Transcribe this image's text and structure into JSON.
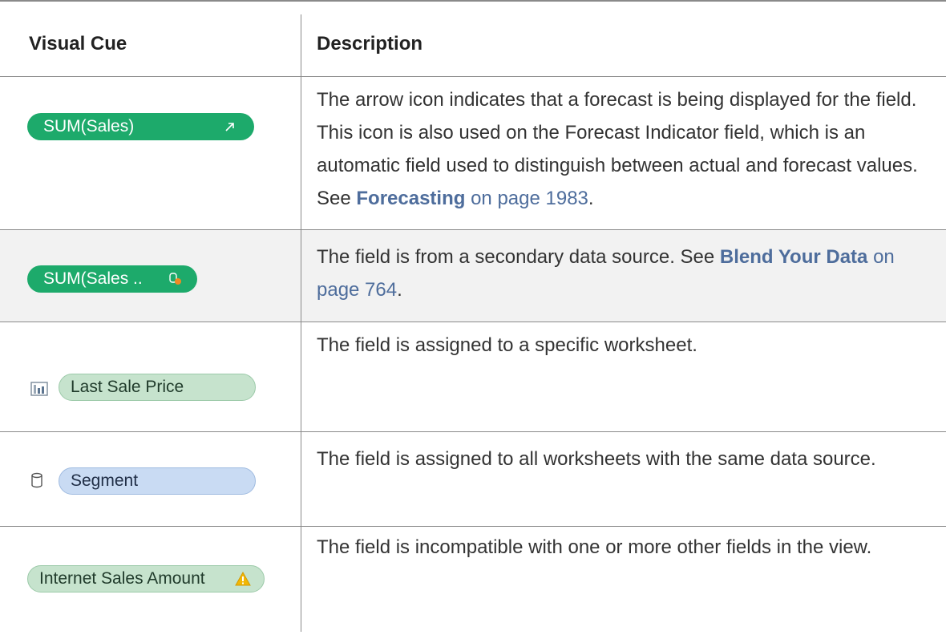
{
  "table": {
    "headers": {
      "visual_cue": "Visual Cue",
      "description": "Description"
    },
    "rows": [
      {
        "cue_label": "SUM(Sales)",
        "cue_icon": "forecast-arrow-icon",
        "description": "The arrow icon indicates that a forecast is being displayed for the field. This icon is also used on the Forecast Indicator field, which is an automatic field used to distinguish between actual and forecast values. See ",
        "xref": "Forecasting",
        "page_ref": " on page 1983",
        "tail": "."
      },
      {
        "cue_label": "SUM(Sales ..",
        "cue_icon": "secondary-source-icon",
        "description": "The field is from a secondary data source. See ",
        "xref": "Blend Your Data",
        "page_ref": " on page 764",
        "tail": "."
      },
      {
        "cue_label": "Last Sale Price",
        "cue_icon": "worksheet-icon",
        "description": "The field is assigned to a specific worksheet."
      },
      {
        "cue_label": "Segment",
        "cue_icon": "datasource-cylinder-icon",
        "description": "The field is assigned to all worksheets with the same data source."
      },
      {
        "cue_label": "Internet Sales Amount",
        "cue_icon": "warning-icon",
        "description": "The field is incompatible with one or more other fields in the view."
      }
    ]
  },
  "colors": {
    "green_pill": "#1daa6b",
    "light_green_pill": "#c6e3cd",
    "blue_pill": "#c9dbf3",
    "link": "#4e6d9c",
    "row_shade": "#f2f2f2",
    "warning": "#f2b705"
  }
}
